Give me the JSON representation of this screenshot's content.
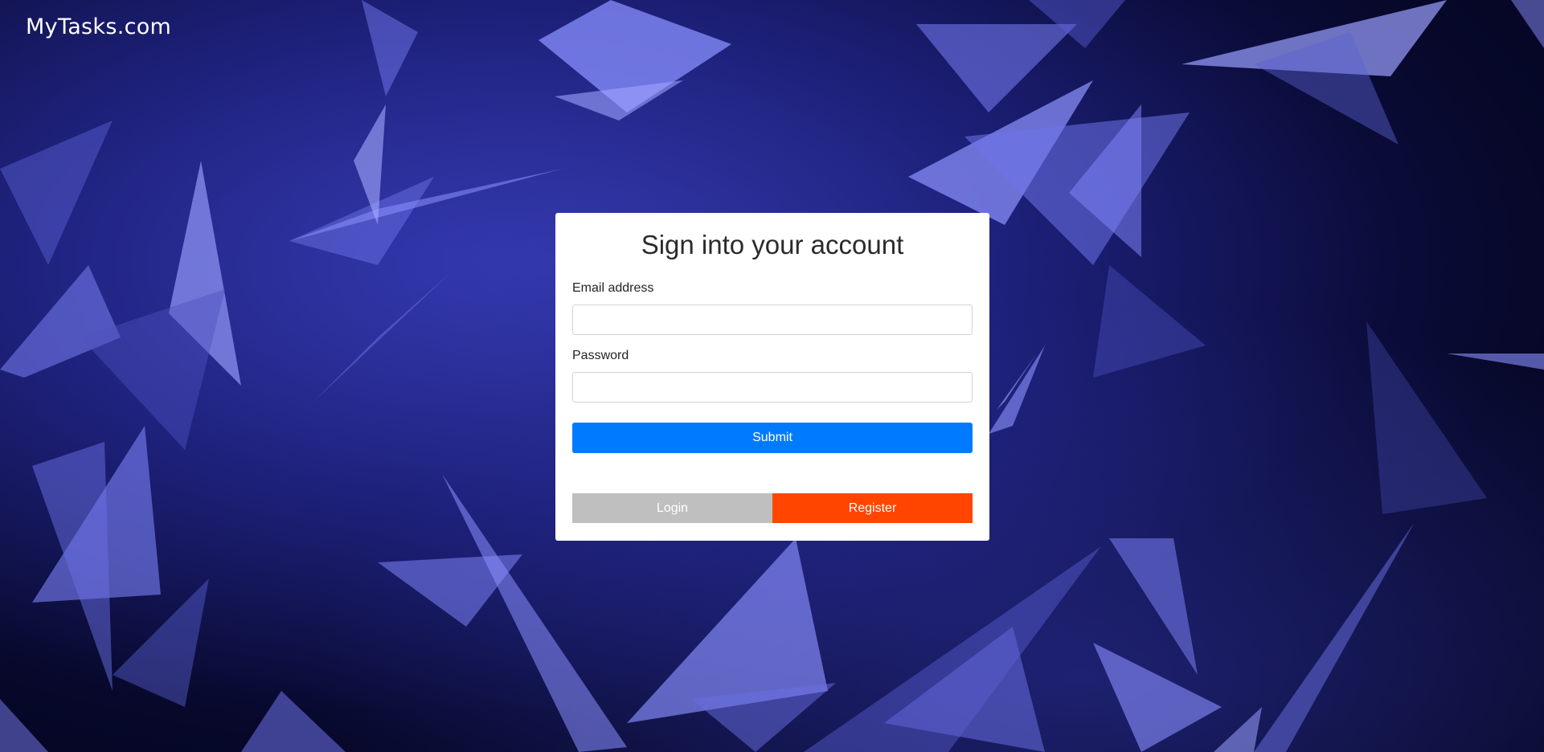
{
  "app": {
    "brand": "MyTasks.com"
  },
  "login_card": {
    "title": "Sign into your account",
    "email_label": "Email address",
    "email_value": "",
    "password_label": "Password",
    "password_value": "",
    "submit_label": "Submit",
    "login_tab_label": "Login",
    "register_tab_label": "Register"
  },
  "colors": {
    "submit": "#007bff",
    "login_tab": "#bfbfbf",
    "register_tab": "#ff4500",
    "background_dark": "#07082a",
    "shard": "#6f76f0"
  }
}
